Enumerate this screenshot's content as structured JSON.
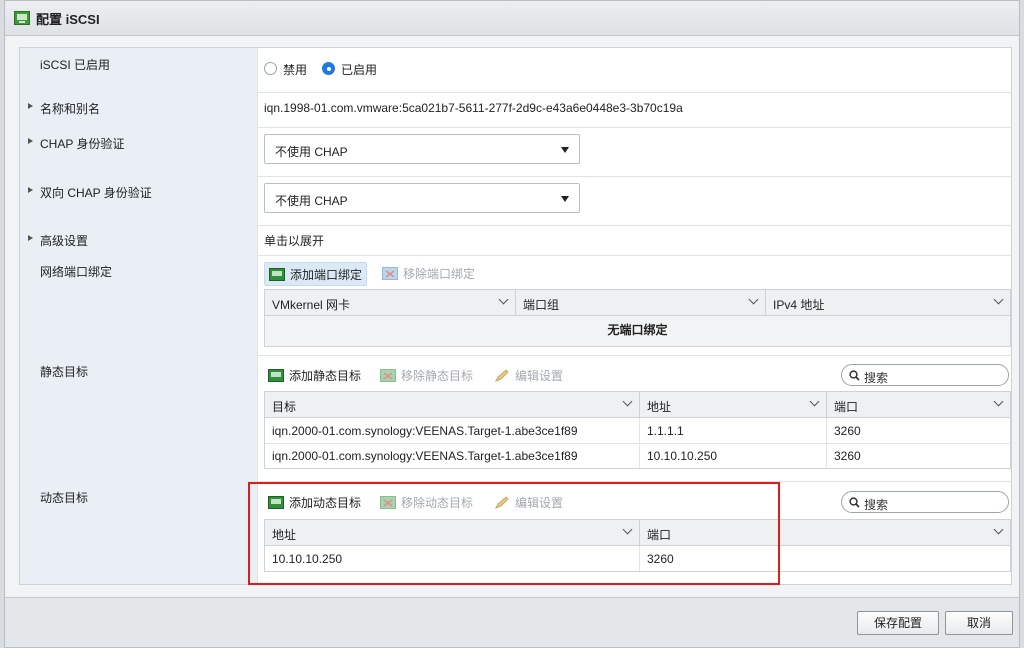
{
  "dialog": {
    "title": "配置 iSCSI"
  },
  "rows": {
    "enabled": {
      "label": "iSCSI 已启用",
      "options": [
        "禁用",
        "已启用"
      ],
      "selected": "已启用"
    },
    "name_alias": {
      "label": "名称和别名",
      "value": "iqn.1998-01.com.vmware:5ca021b7-5611-277f-2d9c-e43a6e0448e3-3b70c19a"
    },
    "chap": {
      "label": "CHAP 身份验证",
      "value": "不使用 CHAP"
    },
    "mutual_chap": {
      "label": "双向 CHAP 身份验证",
      "value": "不使用 CHAP"
    },
    "advanced": {
      "label": "高级设置",
      "value": "单击以展开"
    },
    "port_binding": {
      "label": "网络端口绑定",
      "add_label": "添加端口绑定",
      "remove_label": "移除端口绑定",
      "columns": [
        "VMkernel 网卡",
        "端口组",
        "IPv4 地址"
      ],
      "empty_text": "无端口绑定"
    },
    "static_targets": {
      "label": "静态目标",
      "add_label": "添加静态目标",
      "remove_label": "移除静态目标",
      "edit_label": "编辑设置",
      "search_placeholder": "搜索",
      "columns": [
        "目标",
        "地址",
        "端口"
      ],
      "rows": [
        [
          "iqn.2000-01.com.synology:VEENAS.Target-1.abe3ce1f89",
          "1.1.1.1",
          "3260"
        ],
        [
          "iqn.2000-01.com.synology:VEENAS.Target-1.abe3ce1f89",
          "10.10.10.250",
          "3260"
        ]
      ]
    },
    "dynamic_targets": {
      "label": "动态目标",
      "add_label": "添加动态目标",
      "remove_label": "移除动态目标",
      "edit_label": "编辑设置",
      "search_placeholder": "搜索",
      "columns": [
        "地址",
        "端口"
      ],
      "rows": [
        [
          "10.10.10.250",
          "3260"
        ]
      ]
    }
  },
  "footer": {
    "save_label": "保存配置",
    "cancel_label": "取消"
  },
  "colors": {
    "accent": "#1f7ae0",
    "highlight_box": "#e11a1a",
    "label_bg": "#e9eff5"
  }
}
